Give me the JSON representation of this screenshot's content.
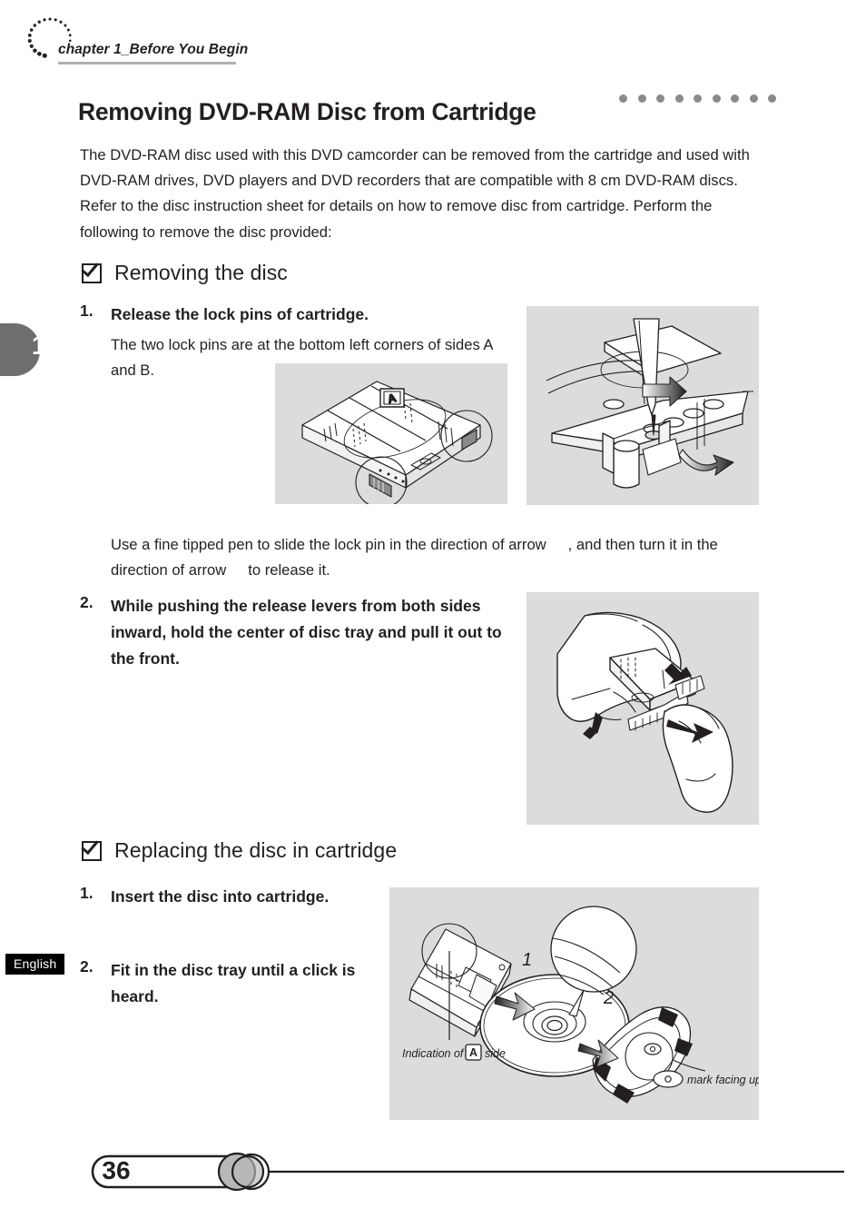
{
  "header": {
    "chapter_label": "chapter 1_Before You Begin",
    "chapter_tab_number": "1",
    "language_badge": "English"
  },
  "title": {
    "text": "Removing DVD-RAM Disc from Cartridge",
    "dot_count": 9,
    "dot_color": "#8a8a8a"
  },
  "intro": {
    "paragraph": "The DVD-RAM disc used with this DVD camcorder can be removed from the cartridge and used with DVD-RAM drives, DVD players and DVD recorders that are compatible with 8 cm DVD-RAM discs. Refer to the disc instruction sheet for details on how to remove disc from cartridge. Perform the following to remove the disc provided:"
  },
  "sections": [
    {
      "id": "removing",
      "heading": "Removing the disc",
      "steps": [
        {
          "num": "1.",
          "text": "Release the lock pins of cartridge."
        },
        {
          "num": "2.",
          "text": "While pushing the release levers from both sides inward, hold the center of disc tray and pull it out to the front."
        }
      ],
      "notes": {
        "lock_pins": "The two lock pins are at the bottom left corners of sides A and B.",
        "fine_pen_a": "Use a fine tipped pen to slide the lock pin in the direction of arrow",
        "fine_pen_b": ", and then turn it in the direction of arrow",
        "fine_pen_c": "to release it."
      }
    },
    {
      "id": "replacing",
      "heading": "Replacing the disc in cartridge",
      "steps": [
        {
          "num": "1.",
          "text": "Insert the disc into cartridge."
        },
        {
          "num": "2.",
          "text": "Fit in the disc tray until a click is heard."
        }
      ]
    }
  ],
  "figures": {
    "cartridge": {
      "caption_letter": "A",
      "description": "DVD-RAM cartridge with two circled lock pin locations at bottom left corners"
    },
    "lockpin": {
      "description": "Close-up of a fine tipped pen inserted into the lock pin hole with slide and turn arrows"
    },
    "hands": {
      "description": "Two hands pushing release levers inward and pulling the disc tray out to the front"
    },
    "replace": {
      "label_1": "1",
      "label_2": "2",
      "indication_prefix": "Indication of",
      "indication_letter": "A",
      "indication_suffix": "side",
      "mark_label": "mark facing up",
      "mark_symbol": "o"
    }
  },
  "footer": {
    "page_number": "36"
  },
  "colors": {
    "figure_background": "#dcdcdc",
    "tab_gray": "#6d6e70",
    "ink": "#231f20"
  }
}
